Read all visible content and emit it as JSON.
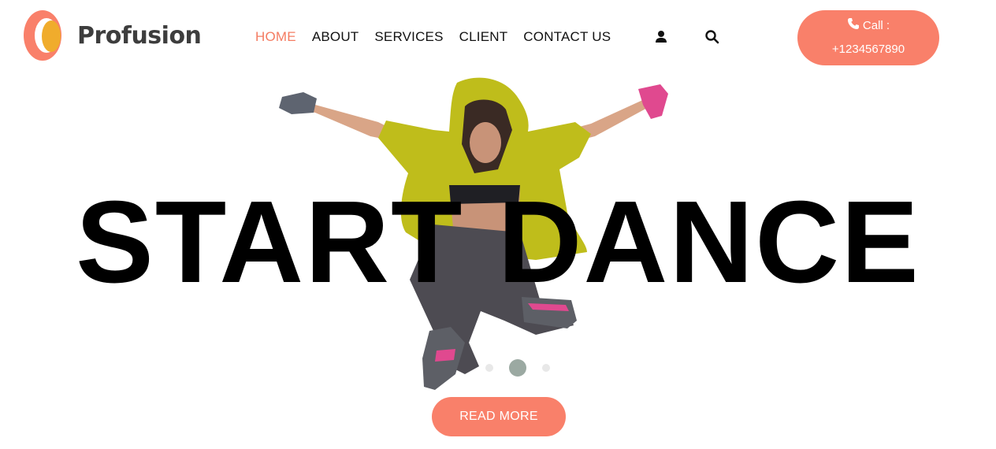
{
  "brand": {
    "name": "Profusion",
    "accent": "#f9806a",
    "logo_inner": "#f0ac2c"
  },
  "nav": {
    "items": [
      {
        "label": "HOME",
        "active": true
      },
      {
        "label": "ABOUT"
      },
      {
        "label": "SERVICES"
      },
      {
        "label": "CLIENT"
      },
      {
        "label": "CONTACT US"
      }
    ],
    "user_icon": "user-icon",
    "search_icon": "search-icon"
  },
  "call": {
    "label": "Call :",
    "number": "+1234567890",
    "icon": "phone-icon"
  },
  "hero": {
    "title": "START DANCE",
    "image": "dancer-jumping-in-yellow-hoodie",
    "slides": {
      "count": 3,
      "active": 2
    },
    "cta": "READ MORE"
  }
}
